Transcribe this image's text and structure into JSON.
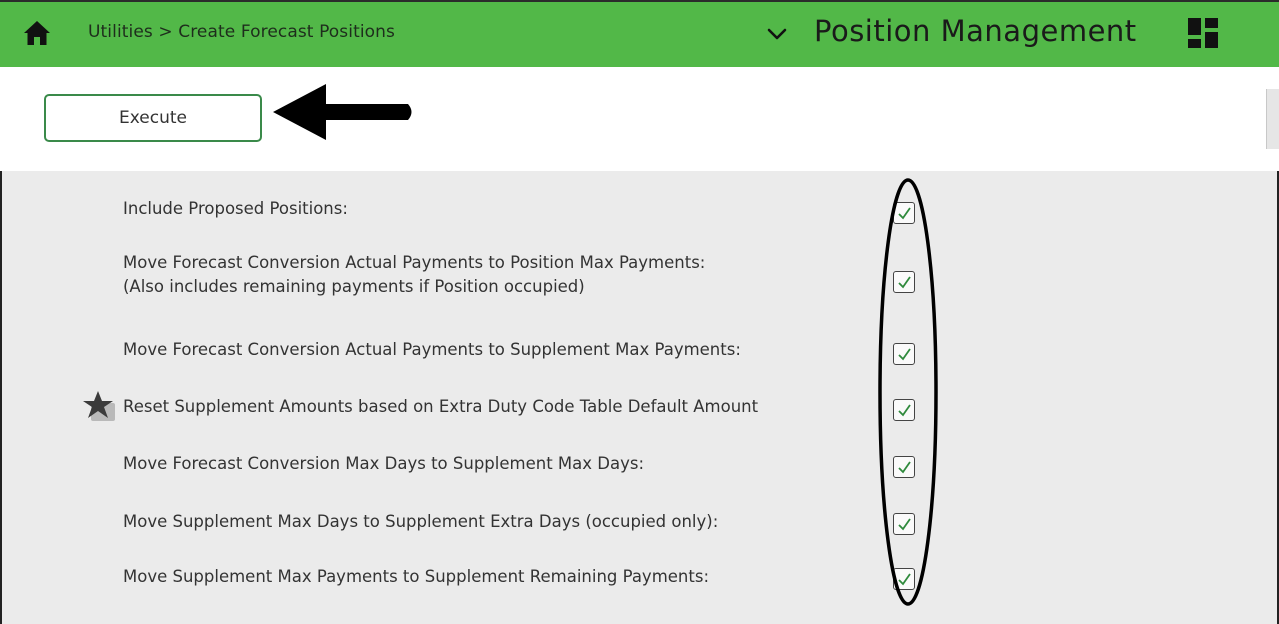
{
  "header": {
    "breadcrumb": "Utilities > Create Forecast Positions",
    "app_title": "Position Management",
    "icons": {
      "home": "home-icon",
      "chevron": "chevron-down-icon",
      "grid": "dashboard-grid-icon"
    },
    "color": "#52b848"
  },
  "toolbar": {
    "execute_label": "Execute"
  },
  "options": [
    {
      "label": "Include Proposed Positions:",
      "checked": true
    },
    {
      "label": "Move Forecast Conversion Actual Payments to Position Max Payments:",
      "sublabel": "(Also includes remaining payments if Position occupied)",
      "checked": true
    },
    {
      "label": "Move Forecast Conversion Actual Payments to Supplement Max Payments:",
      "checked": true
    },
    {
      "label": "Reset Supplement Amounts based on Extra Duty Code Table Default Amount",
      "checked": true,
      "icon": "star-icon"
    },
    {
      "label": "Move Forecast Conversion Max Days to Supplement Max Days:",
      "checked": true
    },
    {
      "label": "Move Supplement Max Days to Supplement Extra Days (occupied only):",
      "checked": true
    },
    {
      "label": "Move Supplement Max Payments to Supplement Remaining Payments:",
      "checked": true
    }
  ]
}
